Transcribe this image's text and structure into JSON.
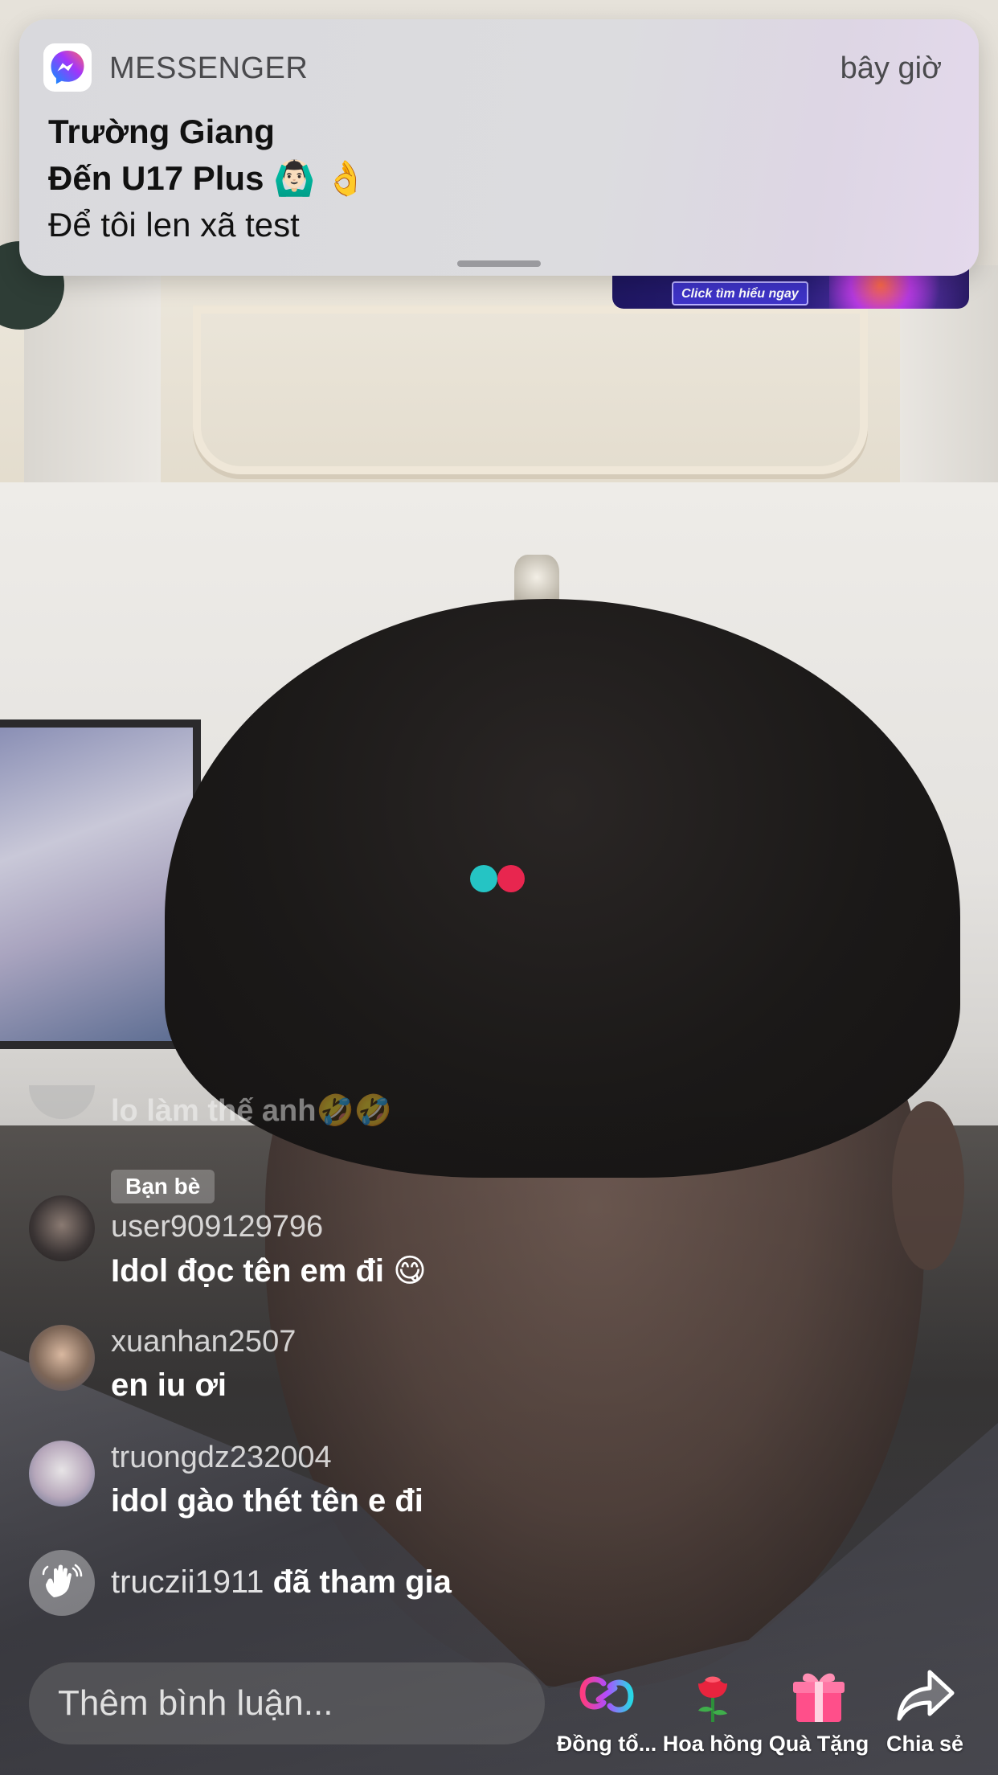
{
  "notification": {
    "app_name": "MESSENGER",
    "time": "bây giờ",
    "sender": "Trường Giang",
    "subject": "Đến U17 Plus 🙆🏻‍♂️ 👌",
    "body": "Để tôi len xã test"
  },
  "ad_banner": {
    "cta": "Click tìm hiểu ngay"
  },
  "comments": {
    "faded_text": "lo làm thế anh🤣🤣",
    "items": [
      {
        "badge": "Bạn bè",
        "user": "user909129796",
        "text": "Idol đọc tên em đi 😋"
      },
      {
        "badge": "",
        "user": "xuanhan2507",
        "text": "en iu ơi"
      },
      {
        "badge": "",
        "user": "truongdz232004",
        "text": "idol gào thét tên e đi"
      }
    ],
    "join": {
      "user": "truczii1911",
      "action": "đã tham gia",
      "icon": "wave-hand-icon"
    }
  },
  "bottom_bar": {
    "input_placeholder": "Thêm bình luận...",
    "actions": [
      {
        "label": "Đồng tổ...",
        "icon": "collab-link-icon"
      },
      {
        "label": "Hoa hồng",
        "icon": "rose-icon"
      },
      {
        "label": "Quà Tặng",
        "icon": "gift-icon"
      },
      {
        "label": "Chia sẻ",
        "icon": "share-icon"
      }
    ]
  },
  "colors": {
    "loader_cyan": "#25c4c4",
    "loader_red": "#e8264f",
    "messenger_gradient_start": "#0695ff",
    "messenger_gradient_end": "#ff6968"
  }
}
